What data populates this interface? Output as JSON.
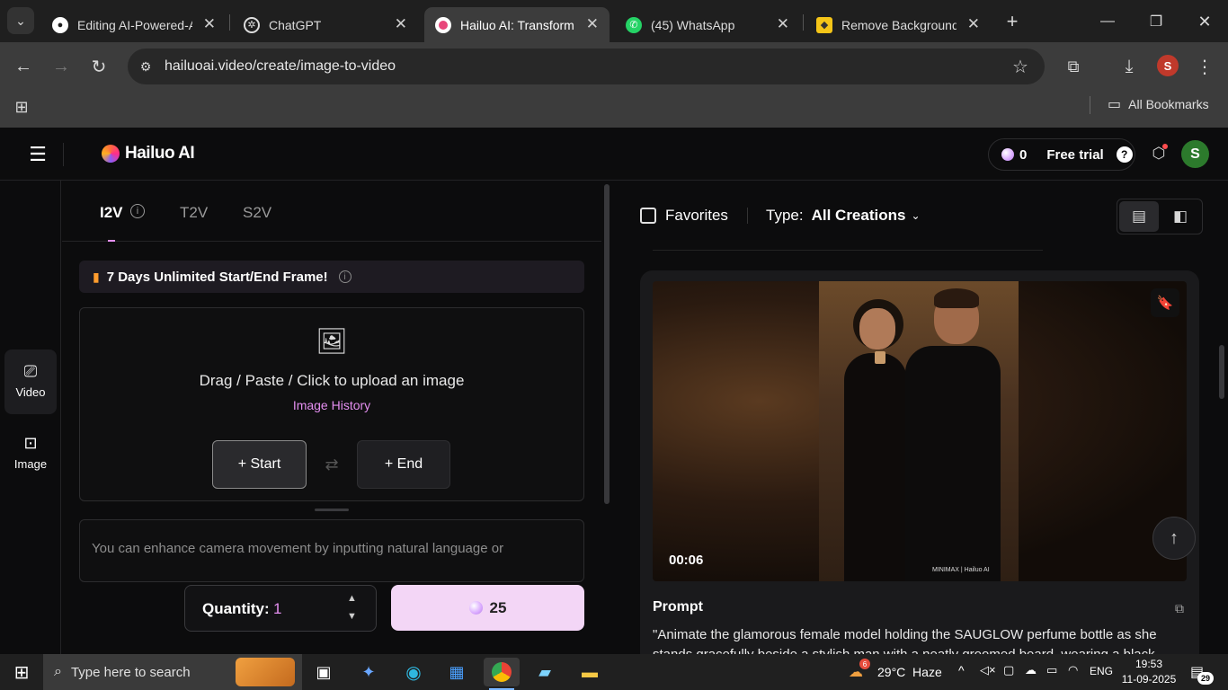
{
  "browser": {
    "tabs": [
      {
        "title": "Editing AI-Powered-A",
        "favicon": "github-icon"
      },
      {
        "title": "ChatGPT",
        "favicon": "openai-icon"
      },
      {
        "title": "Hailuo AI: Transform",
        "favicon": "hailuo-icon"
      },
      {
        "title": "(45) WhatsApp",
        "favicon": "whatsapp-icon"
      },
      {
        "title": "Remove Background",
        "favicon": "removebg-icon"
      }
    ],
    "url": "hailuoai.video/create/image-to-video",
    "profile_initial": "S",
    "bookmarks_label": "All Bookmarks"
  },
  "app": {
    "logo_text": "Hailuo AI",
    "credits": "0",
    "free_trial": "Free trial",
    "user_initial": "S",
    "sidenav": [
      {
        "label": "Video",
        "icon": "video-icon"
      },
      {
        "label": "Image",
        "icon": "image-icon"
      }
    ],
    "mode_tabs": [
      "I2V",
      "T2V",
      "S2V"
    ],
    "promo": "7 Days Unlimited Start/End Frame!",
    "upload": {
      "text": "Drag / Paste / Click to upload an image",
      "history": "Image History",
      "start": "+ Start",
      "end": "+ End"
    },
    "prompt_placeholder": "You can enhance camera movement by inputting natural language or",
    "quantity_label": "Quantity:",
    "quantity_value": "1",
    "generate_cost": "25",
    "filters": {
      "favorites": "Favorites",
      "type_label": "Type:",
      "type_value": "All Creations"
    },
    "card": {
      "duration": "00:06",
      "watermark": "MINIMAX | Hailuo AI",
      "prompt_label": "Prompt",
      "prompt_text": "\"Animate the glamorous female model holding the SAUGLOW perfume bottle as she stands gracefully beside a stylish man with a neatly groomed beard, wearing a black"
    }
  },
  "taskbar": {
    "search_placeholder": "Type here to search",
    "weather": "29°C  Haze",
    "weather_badge": "6",
    "lang": "ENG",
    "time": "19:53",
    "date": "11-09-2025",
    "notif_count": "29"
  },
  "colors": {
    "accent_pink": "#e48ff0",
    "generate_bg": "#f3d6f6",
    "avatar_green": "#2c7a2c",
    "profile_red": "#c0392b"
  }
}
